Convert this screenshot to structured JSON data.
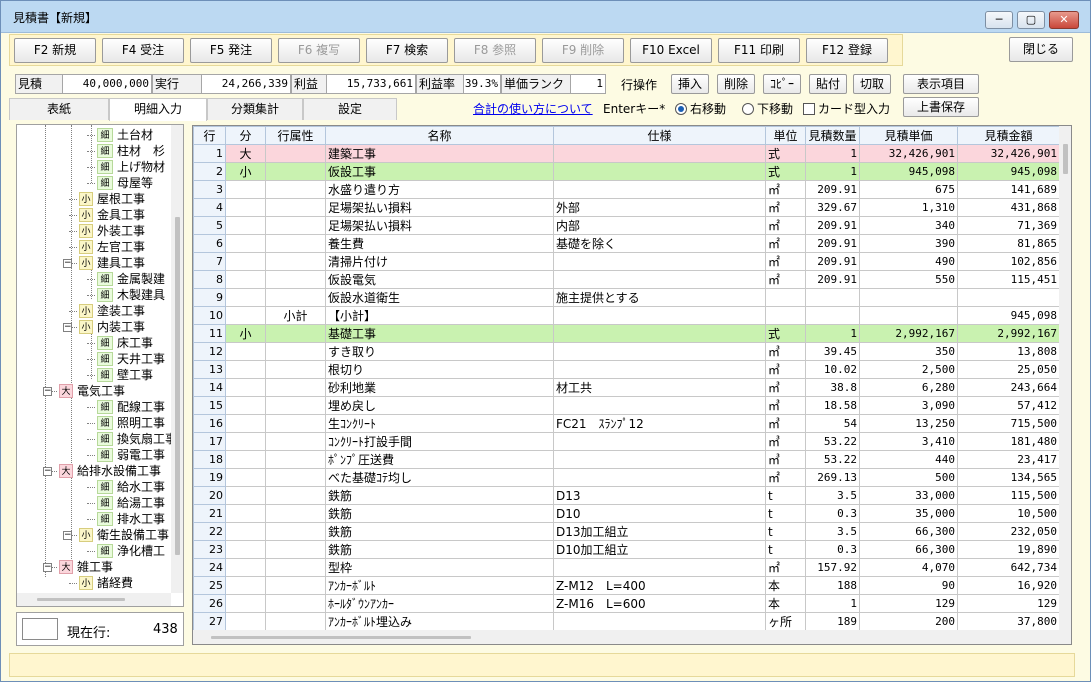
{
  "window": {
    "title": "見積書【新規】",
    "minimize": "─",
    "maximize": "▢",
    "close": "✕"
  },
  "fkeys": [
    {
      "label": "F2 新規",
      "enabled": true
    },
    {
      "label": "F4 受注",
      "enabled": true
    },
    {
      "label": "F5 発注",
      "enabled": true
    },
    {
      "label": "F6 複写",
      "enabled": false
    },
    {
      "label": "F7 検索",
      "enabled": true
    },
    {
      "label": "F8 参照",
      "enabled": false
    },
    {
      "label": "F9 削除",
      "enabled": false
    },
    {
      "label": "F10 Excel",
      "enabled": true
    },
    {
      "label": "F11 印刷",
      "enabled": true
    },
    {
      "label": "F12 登録",
      "enabled": true
    }
  ],
  "close_label": "閉じる",
  "summary": {
    "estimate_label": "見積",
    "estimate_value": "40,000,000",
    "actual_label": "実行",
    "actual_value": "24,266,339",
    "profit_label": "利益",
    "profit_value": "15,733,661",
    "rate_label": "利益率",
    "rate_value": "39.3%",
    "rank_label": "単価ランク",
    "rank_value": "1"
  },
  "row_ops": {
    "label": "行操作",
    "insert": "挿入",
    "delete": "削除",
    "copy": "ｺﾋﾟｰ",
    "paste": "貼付",
    "cut": "切取",
    "display_items": "表示項目",
    "overwrite_save": "上書保存"
  },
  "help_link": "合計の使い方について",
  "enter_key_label": "Enterキー*",
  "radio_right": "右移動",
  "radio_down": "下移動",
  "card_input": "カード型入力",
  "tabs": [
    "表紙",
    "明細入力",
    "分類集計",
    "設定"
  ],
  "active_tab": 1,
  "tree": [
    {
      "icon": "細",
      "label": "土台材"
    },
    {
      "icon": "細",
      "label": "柱材　杉"
    },
    {
      "icon": "細",
      "label": "上げ物材"
    },
    {
      "icon": "細",
      "label": "母屋等"
    },
    {
      "icon": "小",
      "label": "屋根工事"
    },
    {
      "icon": "小",
      "label": "金具工事"
    },
    {
      "icon": "小",
      "label": "外装工事"
    },
    {
      "icon": "小",
      "label": "左官工事"
    },
    {
      "icon": "小",
      "label": "建具工事"
    },
    {
      "icon": "細",
      "label": "金属製建"
    },
    {
      "icon": "細",
      "label": "木製建具"
    },
    {
      "icon": "小",
      "label": "塗装工事"
    },
    {
      "icon": "小",
      "label": "内装工事"
    },
    {
      "icon": "細",
      "label": "床工事"
    },
    {
      "icon": "細",
      "label": "天井工事"
    },
    {
      "icon": "細",
      "label": "壁工事"
    },
    {
      "icon": "大",
      "label": "電気工事"
    },
    {
      "icon": "細",
      "label": "配線工事"
    },
    {
      "icon": "細",
      "label": "照明工事"
    },
    {
      "icon": "細",
      "label": "換気扇工事"
    },
    {
      "icon": "細",
      "label": "弱電工事"
    },
    {
      "icon": "大",
      "label": "給排水設備工事"
    },
    {
      "icon": "細",
      "label": "給水工事"
    },
    {
      "icon": "細",
      "label": "給湯工事"
    },
    {
      "icon": "細",
      "label": "排水工事"
    },
    {
      "icon": "小",
      "label": "衛生設備工事"
    },
    {
      "icon": "細",
      "label": "浄化槽工"
    },
    {
      "icon": "大",
      "label": "雑工事"
    },
    {
      "icon": "小",
      "label": "諸経費"
    }
  ],
  "current_row_label": "現在行:",
  "current_row_value": "438",
  "grid": {
    "headers": [
      "行",
      "分",
      "行属性",
      "名称",
      "仕様",
      "単位",
      "見積数量",
      "見積単価",
      "見積金額"
    ],
    "rows": [
      [
        "1",
        "大",
        "",
        "建築工事",
        "",
        "式",
        "1",
        "32,426,901",
        "32,426,901"
      ],
      [
        "2",
        "小",
        "",
        "仮設工事",
        "",
        "式",
        "1",
        "945,098",
        "945,098"
      ],
      [
        "3",
        "",
        "",
        "水盛り遣り方",
        "",
        "㎡",
        "209.91",
        "675",
        "141,689"
      ],
      [
        "4",
        "",
        "",
        "足場架払い損料",
        "外部",
        "㎡",
        "329.67",
        "1,310",
        "431,868"
      ],
      [
        "5",
        "",
        "",
        "足場架払い損料",
        "内部",
        "㎡",
        "209.91",
        "340",
        "71,369"
      ],
      [
        "6",
        "",
        "",
        "養生費",
        "基礎を除く",
        "㎡",
        "209.91",
        "390",
        "81,865"
      ],
      [
        "7",
        "",
        "",
        "清掃片付け",
        "",
        "㎡",
        "209.91",
        "490",
        "102,856"
      ],
      [
        "8",
        "",
        "",
        "仮設電気",
        "",
        "㎡",
        "209.91",
        "550",
        "115,451"
      ],
      [
        "9",
        "",
        "",
        "仮設水道衛生",
        "施主提供とする",
        "",
        "",
        "",
        ""
      ],
      [
        "10",
        "",
        "小計",
        "【小計】",
        "",
        "",
        "",
        "",
        "945,098"
      ],
      [
        "11",
        "小",
        "",
        "基礎工事",
        "",
        "式",
        "1",
        "2,992,167",
        "2,992,167"
      ],
      [
        "12",
        "",
        "",
        "すき取り",
        "",
        "㎥",
        "39.45",
        "350",
        "13,808"
      ],
      [
        "13",
        "",
        "",
        "根切り",
        "",
        "㎥",
        "10.02",
        "2,500",
        "25,050"
      ],
      [
        "14",
        "",
        "",
        "砂利地業",
        "材工共",
        "㎥",
        "38.8",
        "6,280",
        "243,664"
      ],
      [
        "15",
        "",
        "",
        "埋め戻し",
        "",
        "㎥",
        "18.58",
        "3,090",
        "57,412"
      ],
      [
        "16",
        "",
        "",
        "生ｺﾝｸﾘｰﾄ",
        "FC21　ｽﾗﾝﾌﾟ12",
        "㎥",
        "54",
        "13,250",
        "715,500"
      ],
      [
        "17",
        "",
        "",
        "ｺﾝｸﾘｰﾄ打設手間",
        "",
        "㎥",
        "53.22",
        "3,410",
        "181,480"
      ],
      [
        "18",
        "",
        "",
        "ﾎﾟﾝﾌﾟ圧送費",
        "",
        "㎥",
        "53.22",
        "440",
        "23,417"
      ],
      [
        "19",
        "",
        "",
        "べた基礎ｺﾃ均し",
        "",
        "㎡",
        "269.13",
        "500",
        "134,565"
      ],
      [
        "20",
        "",
        "",
        "鉄筋",
        "D13",
        "t",
        "3.5",
        "33,000",
        "115,500"
      ],
      [
        "21",
        "",
        "",
        "鉄筋",
        "D10",
        "t",
        "0.3",
        "35,000",
        "10,500"
      ],
      [
        "22",
        "",
        "",
        "鉄筋",
        "D13加工組立",
        "t",
        "3.5",
        "66,300",
        "232,050"
      ],
      [
        "23",
        "",
        "",
        "鉄筋",
        "D10加工組立",
        "t",
        "0.3",
        "66,300",
        "19,890"
      ],
      [
        "24",
        "",
        "",
        "型枠",
        "",
        "㎡",
        "157.92",
        "4,070",
        "642,734"
      ],
      [
        "25",
        "",
        "",
        "ｱﾝｶｰﾎﾞﾙﾄ",
        "Z-M12　L=400",
        "本",
        "188",
        "90",
        "16,920"
      ],
      [
        "26",
        "",
        "",
        "ﾎｰﾙﾀﾞｳﾝｱﾝｶｰ",
        "Z-M16　L=600",
        "本",
        "1",
        "129",
        "129"
      ],
      [
        "27",
        "",
        "",
        "ｱﾝｶｰﾎﾞﾙﾄ埋込み",
        "",
        "ヶ所",
        "189",
        "200",
        "37,800"
      ]
    ]
  }
}
